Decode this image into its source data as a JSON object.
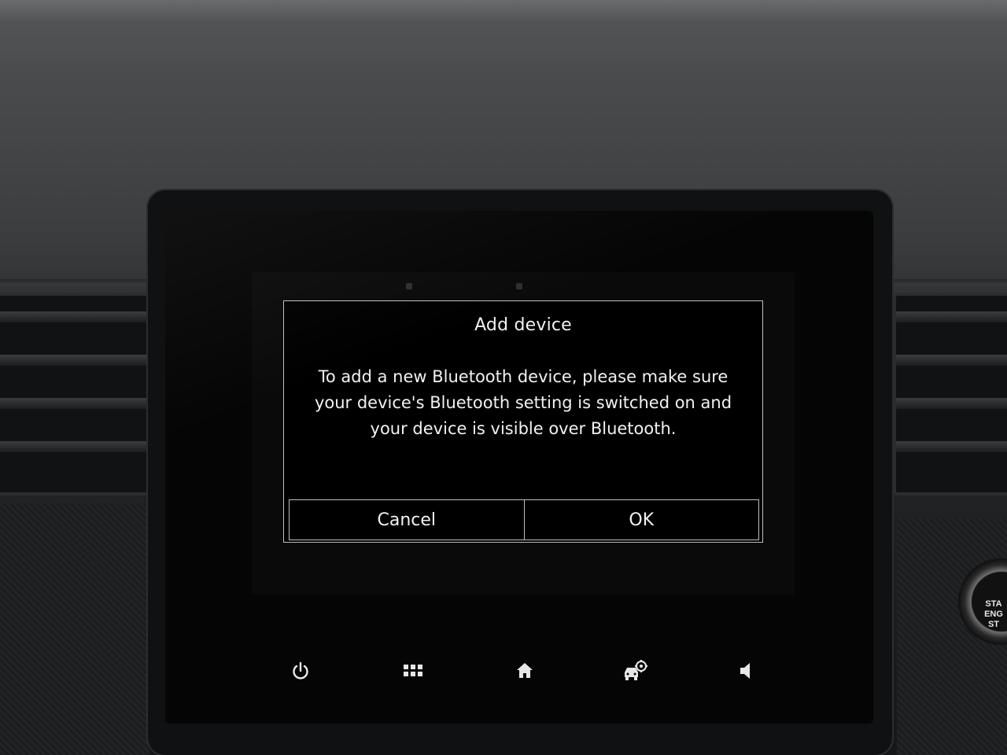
{
  "dialog": {
    "title": "Add device",
    "message": "To add a new Bluetooth device, please make sure your device's Bluetooth setting is switched on and your device is visible over Bluetooth.",
    "cancel_label": "Cancel",
    "ok_label": "OK"
  },
  "navbar": {
    "items": [
      {
        "icon": "power-icon"
      },
      {
        "icon": "apps-grid-icon"
      },
      {
        "icon": "home-icon"
      },
      {
        "icon": "car-settings-icon"
      },
      {
        "icon": "volume-icon"
      }
    ]
  },
  "dashboard": {
    "start_button_lines": [
      "STA",
      "ENG",
      "ST"
    ]
  },
  "colors": {
    "screen_background": "#050506",
    "dialog_border": "#bfc0c2",
    "text": "#f2f2f2",
    "icon": "#e8e8e8"
  }
}
